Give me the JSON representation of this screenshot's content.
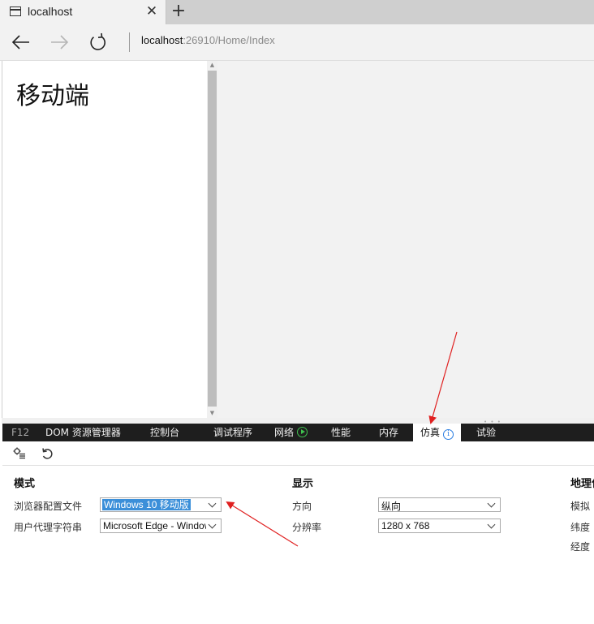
{
  "browser": {
    "tab_title": "localhost",
    "close_glyph": "✕",
    "new_tab_glyph": "+",
    "address_host": "localhost",
    "address_rest": ":26910/Home/Index"
  },
  "page": {
    "heading": "移动端"
  },
  "devtools": {
    "f12_label": "F12",
    "tabs": [
      {
        "label": "DOM 资源管理器"
      },
      {
        "label": "控制台"
      },
      {
        "label": "调试程序"
      },
      {
        "label": "网络"
      },
      {
        "label": "性能"
      },
      {
        "label": "内存"
      },
      {
        "label": "仿真"
      },
      {
        "label": "试验"
      }
    ],
    "active_tab": "仿真",
    "info_glyph": "i"
  },
  "emulation": {
    "mode": {
      "title": "模式",
      "browser_profile_label": "浏览器配置文件",
      "browser_profile_value": "Windows 10 移动版",
      "user_agent_label": "用户代理字符串",
      "user_agent_value": "Microsoft Edge - Windows"
    },
    "display": {
      "title": "显示",
      "orientation_label": "方向",
      "orientation_value": "纵向",
      "resolution_label": "分辨率",
      "resolution_value": "1280 x 768"
    },
    "geolocation": {
      "title": "地理位置",
      "simulate_label": "模拟",
      "latitude_label": "纬度",
      "longitude_label": "经度"
    }
  },
  "colors": {
    "accent": "#3b8fd9",
    "annotation_arrow": "#e02020",
    "devtools_bar": "#1e1e1e",
    "network_play": "#3fc24f"
  }
}
